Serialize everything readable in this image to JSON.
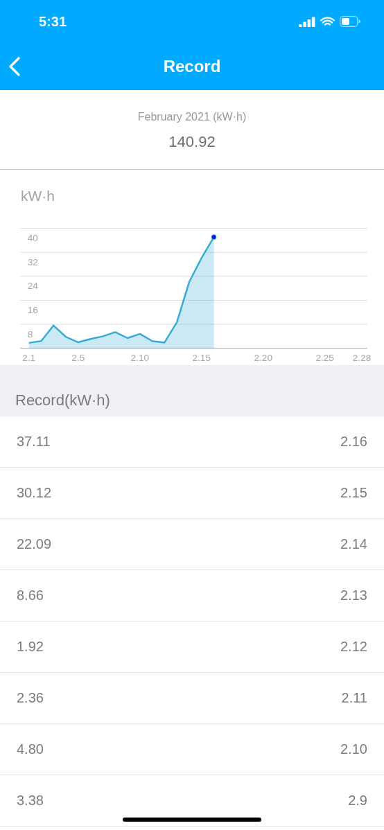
{
  "status_bar": {
    "time": "5:31"
  },
  "nav_bar": {
    "title": "Record"
  },
  "summary": {
    "label": "February 2021 (kW·h)",
    "total": "140.92"
  },
  "chart_data": {
    "type": "area",
    "ylabel": "kW·h",
    "categories": [
      "2.1",
      null,
      null,
      null,
      "2.5",
      null,
      null,
      null,
      null,
      "2.10",
      null,
      null,
      null,
      null,
      "2.15",
      null,
      null,
      null,
      null,
      "2.20",
      null,
      null,
      null,
      null,
      "2.25",
      null,
      null,
      "2.28"
    ],
    "series": [
      {
        "color": "#34aad8",
        "values": [
          1.8,
          2.4,
          7.6,
          3.8,
          2.0,
          3.1,
          4.0,
          5.4,
          3.4,
          4.8,
          2.4,
          1.9,
          8.7,
          22.1,
          30.1,
          37.1,
          null,
          null,
          null,
          null,
          null,
          null,
          null,
          null,
          null,
          null,
          null,
          null
        ]
      }
    ],
    "ylim": [
      0,
      40
    ],
    "yticks": [
      8,
      16,
      24,
      32,
      40
    ],
    "grid": true
  },
  "records": {
    "title": "Record(kW·h)",
    "rows": [
      {
        "value": "37.11",
        "date": "2.16"
      },
      {
        "value": "30.12",
        "date": "2.15"
      },
      {
        "value": "22.09",
        "date": "2.14"
      },
      {
        "value": "8.66",
        "date": "2.13"
      },
      {
        "value": "1.92",
        "date": "2.12"
      },
      {
        "value": "2.36",
        "date": "2.11"
      },
      {
        "value": "4.80",
        "date": "2.10"
      },
      {
        "value": "3.38",
        "date": "2.9"
      }
    ]
  }
}
